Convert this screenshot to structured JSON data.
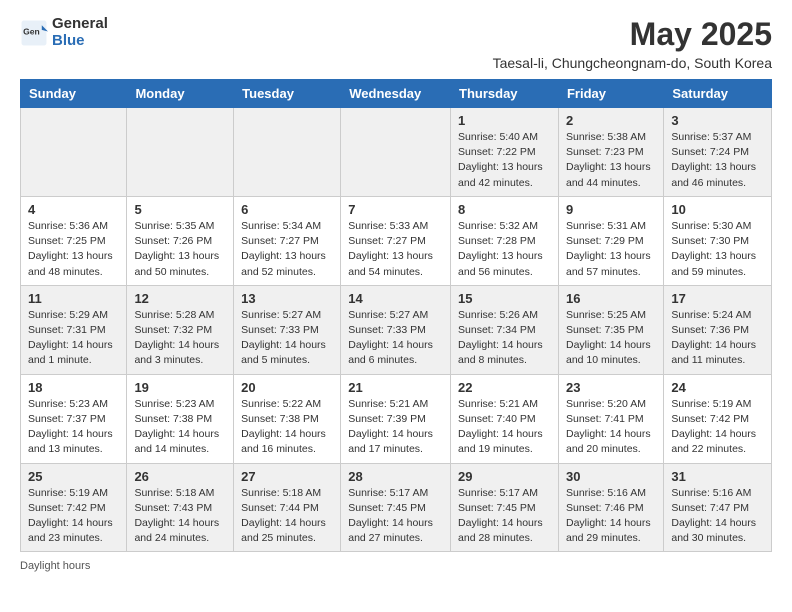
{
  "logo": {
    "general": "General",
    "blue": "Blue"
  },
  "title": "May 2025",
  "subtitle": "Taesal-li, Chungcheongnam-do, South Korea",
  "weekdays": [
    "Sunday",
    "Monday",
    "Tuesday",
    "Wednesday",
    "Thursday",
    "Friday",
    "Saturday"
  ],
  "weeks": [
    [
      {
        "day": "",
        "info": ""
      },
      {
        "day": "",
        "info": ""
      },
      {
        "day": "",
        "info": ""
      },
      {
        "day": "",
        "info": ""
      },
      {
        "day": "1",
        "info": "Sunrise: 5:40 AM\nSunset: 7:22 PM\nDaylight: 13 hours and 42 minutes."
      },
      {
        "day": "2",
        "info": "Sunrise: 5:38 AM\nSunset: 7:23 PM\nDaylight: 13 hours and 44 minutes."
      },
      {
        "day": "3",
        "info": "Sunrise: 5:37 AM\nSunset: 7:24 PM\nDaylight: 13 hours and 46 minutes."
      }
    ],
    [
      {
        "day": "4",
        "info": "Sunrise: 5:36 AM\nSunset: 7:25 PM\nDaylight: 13 hours and 48 minutes."
      },
      {
        "day": "5",
        "info": "Sunrise: 5:35 AM\nSunset: 7:26 PM\nDaylight: 13 hours and 50 minutes."
      },
      {
        "day": "6",
        "info": "Sunrise: 5:34 AM\nSunset: 7:27 PM\nDaylight: 13 hours and 52 minutes."
      },
      {
        "day": "7",
        "info": "Sunrise: 5:33 AM\nSunset: 7:27 PM\nDaylight: 13 hours and 54 minutes."
      },
      {
        "day": "8",
        "info": "Sunrise: 5:32 AM\nSunset: 7:28 PM\nDaylight: 13 hours and 56 minutes."
      },
      {
        "day": "9",
        "info": "Sunrise: 5:31 AM\nSunset: 7:29 PM\nDaylight: 13 hours and 57 minutes."
      },
      {
        "day": "10",
        "info": "Sunrise: 5:30 AM\nSunset: 7:30 PM\nDaylight: 13 hours and 59 minutes."
      }
    ],
    [
      {
        "day": "11",
        "info": "Sunrise: 5:29 AM\nSunset: 7:31 PM\nDaylight: 14 hours and 1 minute."
      },
      {
        "day": "12",
        "info": "Sunrise: 5:28 AM\nSunset: 7:32 PM\nDaylight: 14 hours and 3 minutes."
      },
      {
        "day": "13",
        "info": "Sunrise: 5:27 AM\nSunset: 7:33 PM\nDaylight: 14 hours and 5 minutes."
      },
      {
        "day": "14",
        "info": "Sunrise: 5:27 AM\nSunset: 7:33 PM\nDaylight: 14 hours and 6 minutes."
      },
      {
        "day": "15",
        "info": "Sunrise: 5:26 AM\nSunset: 7:34 PM\nDaylight: 14 hours and 8 minutes."
      },
      {
        "day": "16",
        "info": "Sunrise: 5:25 AM\nSunset: 7:35 PM\nDaylight: 14 hours and 10 minutes."
      },
      {
        "day": "17",
        "info": "Sunrise: 5:24 AM\nSunset: 7:36 PM\nDaylight: 14 hours and 11 minutes."
      }
    ],
    [
      {
        "day": "18",
        "info": "Sunrise: 5:23 AM\nSunset: 7:37 PM\nDaylight: 14 hours and 13 minutes."
      },
      {
        "day": "19",
        "info": "Sunrise: 5:23 AM\nSunset: 7:38 PM\nDaylight: 14 hours and 14 minutes."
      },
      {
        "day": "20",
        "info": "Sunrise: 5:22 AM\nSunset: 7:38 PM\nDaylight: 14 hours and 16 minutes."
      },
      {
        "day": "21",
        "info": "Sunrise: 5:21 AM\nSunset: 7:39 PM\nDaylight: 14 hours and 17 minutes."
      },
      {
        "day": "22",
        "info": "Sunrise: 5:21 AM\nSunset: 7:40 PM\nDaylight: 14 hours and 19 minutes."
      },
      {
        "day": "23",
        "info": "Sunrise: 5:20 AM\nSunset: 7:41 PM\nDaylight: 14 hours and 20 minutes."
      },
      {
        "day": "24",
        "info": "Sunrise: 5:19 AM\nSunset: 7:42 PM\nDaylight: 14 hours and 22 minutes."
      }
    ],
    [
      {
        "day": "25",
        "info": "Sunrise: 5:19 AM\nSunset: 7:42 PM\nDaylight: 14 hours and 23 minutes."
      },
      {
        "day": "26",
        "info": "Sunrise: 5:18 AM\nSunset: 7:43 PM\nDaylight: 14 hours and 24 minutes."
      },
      {
        "day": "27",
        "info": "Sunrise: 5:18 AM\nSunset: 7:44 PM\nDaylight: 14 hours and 25 minutes."
      },
      {
        "day": "28",
        "info": "Sunrise: 5:17 AM\nSunset: 7:45 PM\nDaylight: 14 hours and 27 minutes."
      },
      {
        "day": "29",
        "info": "Sunrise: 5:17 AM\nSunset: 7:45 PM\nDaylight: 14 hours and 28 minutes."
      },
      {
        "day": "30",
        "info": "Sunrise: 5:16 AM\nSunset: 7:46 PM\nDaylight: 14 hours and 29 minutes."
      },
      {
        "day": "31",
        "info": "Sunrise: 5:16 AM\nSunset: 7:47 PM\nDaylight: 14 hours and 30 minutes."
      }
    ]
  ],
  "footer": "Daylight hours"
}
